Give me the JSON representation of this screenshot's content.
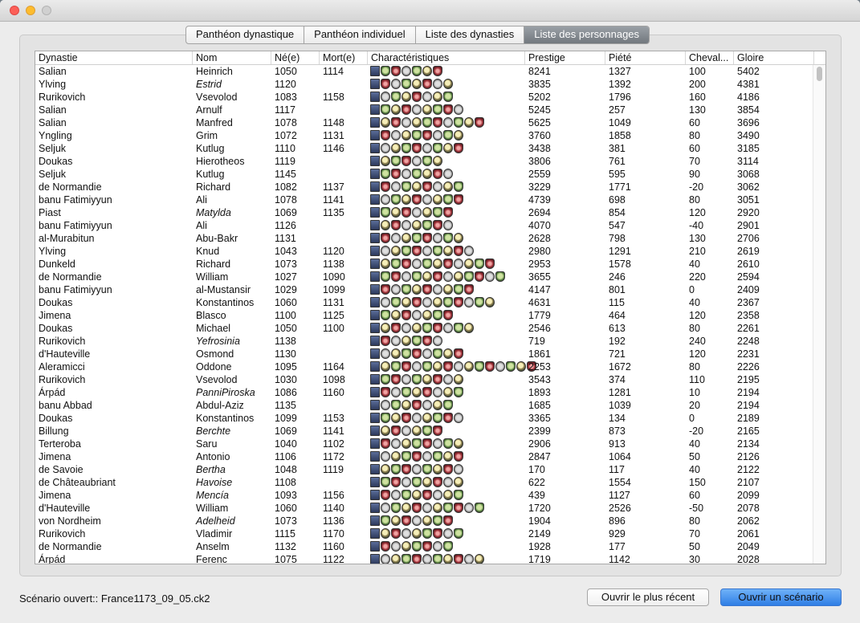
{
  "tabs": [
    {
      "label": "Panthéon dynastique",
      "active": false
    },
    {
      "label": "Panthéon individuel",
      "active": false
    },
    {
      "label": "Liste des dynasties",
      "active": false
    },
    {
      "label": "Liste des personnages",
      "active": true
    }
  ],
  "table": {
    "columns": [
      "Dynastie",
      "Nom",
      "Né(e)",
      "Mort(e)",
      "Charactéristiques",
      "Prestige",
      "Piété",
      "Cheval...",
      "Gloire"
    ],
    "rows": [
      {
        "dynasty": "Salian",
        "name": "Heinrich",
        "italic": false,
        "born": "1050",
        "died": "1114",
        "traits": 7,
        "prestige": "8241",
        "piety": "1327",
        "chivalry": "100",
        "glory": "5402"
      },
      {
        "dynasty": "Ylving",
        "name": "Estrid",
        "italic": true,
        "born": "1120",
        "died": "",
        "traits": 8,
        "prestige": "3835",
        "piety": "1392",
        "chivalry": "200",
        "glory": "4381"
      },
      {
        "dynasty": "Rurikovich",
        "name": "Vsevolod",
        "italic": false,
        "born": "1083",
        "died": "1158",
        "traits": 8,
        "prestige": "5202",
        "piety": "1796",
        "chivalry": "160",
        "glory": "4186"
      },
      {
        "dynasty": "Salian",
        "name": "Arnulf",
        "italic": false,
        "born": "1117",
        "died": "",
        "traits": 9,
        "prestige": "5245",
        "piety": "257",
        "chivalry": "130",
        "glory": "3854"
      },
      {
        "dynasty": "Salian",
        "name": "Manfred",
        "italic": false,
        "born": "1078",
        "died": "1148",
        "traits": 11,
        "prestige": "5625",
        "piety": "1049",
        "chivalry": "60",
        "glory": "3696"
      },
      {
        "dynasty": "Yngling",
        "name": "Grim",
        "italic": false,
        "born": "1072",
        "died": "1131",
        "traits": 9,
        "prestige": "3760",
        "piety": "1858",
        "chivalry": "80",
        "glory": "3490"
      },
      {
        "dynasty": "Seljuk",
        "name": "Kutlug",
        "italic": false,
        "born": "1110",
        "died": "1146",
        "traits": 9,
        "prestige": "3438",
        "piety": "381",
        "chivalry": "60",
        "glory": "3185"
      },
      {
        "dynasty": "Doukas",
        "name": "Hierotheos",
        "italic": false,
        "born": "1119",
        "died": "",
        "traits": 7,
        "prestige": "3806",
        "piety": "761",
        "chivalry": "70",
        "glory": "3114"
      },
      {
        "dynasty": "Seljuk",
        "name": "Kutlug",
        "italic": false,
        "born": "1145",
        "died": "",
        "traits": 8,
        "prestige": "2559",
        "piety": "595",
        "chivalry": "90",
        "glory": "3068"
      },
      {
        "dynasty": "de Normandie",
        "name": "Richard",
        "italic": false,
        "born": "1082",
        "died": "1137",
        "traits": 9,
        "prestige": "3229",
        "piety": "1771",
        "chivalry": "-20",
        "glory": "3062"
      },
      {
        "dynasty": "banu Fatimiyyun",
        "name": "Ali",
        "italic": false,
        "born": "1078",
        "died": "1141",
        "traits": 9,
        "prestige": "4739",
        "piety": "698",
        "chivalry": "80",
        "glory": "3051"
      },
      {
        "dynasty": "Piast",
        "name": "Matylda",
        "italic": true,
        "born": "1069",
        "died": "1135",
        "traits": 8,
        "prestige": "2694",
        "piety": "854",
        "chivalry": "120",
        "glory": "2920"
      },
      {
        "dynasty": "banu Fatimiyyun",
        "name": "Ali",
        "italic": false,
        "born": "1126",
        "died": "",
        "traits": 8,
        "prestige": "4070",
        "piety": "547",
        "chivalry": "-40",
        "glory": "2901"
      },
      {
        "dynasty": "al-Murabitun",
        "name": "Abu-Bakr",
        "italic": false,
        "born": "1131",
        "died": "",
        "traits": 9,
        "prestige": "2628",
        "piety": "798",
        "chivalry": "130",
        "glory": "2706"
      },
      {
        "dynasty": "Ylving",
        "name": "Knud",
        "italic": false,
        "born": "1043",
        "died": "1120",
        "traits": 10,
        "prestige": "2980",
        "piety": "1291",
        "chivalry": "210",
        "glory": "2619"
      },
      {
        "dynasty": "Dunkeld",
        "name": "Richard",
        "italic": false,
        "born": "1073",
        "died": "1138",
        "traits": 12,
        "prestige": "2953",
        "piety": "1578",
        "chivalry": "40",
        "glory": "2610"
      },
      {
        "dynasty": "de Normandie",
        "name": "William",
        "italic": false,
        "born": "1027",
        "died": "1090",
        "traits": 13,
        "prestige": "3655",
        "piety": "246",
        "chivalry": "220",
        "glory": "2594"
      },
      {
        "dynasty": "banu Fatimiyyun",
        "name": "al-Mustansir",
        "italic": false,
        "born": "1029",
        "died": "1099",
        "traits": 10,
        "prestige": "4147",
        "piety": "801",
        "chivalry": "0",
        "glory": "2409"
      },
      {
        "dynasty": "Doukas",
        "name": "Konstantinos",
        "italic": false,
        "born": "1060",
        "died": "1131",
        "traits": 12,
        "prestige": "4631",
        "piety": "115",
        "chivalry": "40",
        "glory": "2367"
      },
      {
        "dynasty": "Jimena",
        "name": "Blasco",
        "italic": false,
        "born": "1100",
        "died": "1125",
        "traits": 8,
        "prestige": "1779",
        "piety": "464",
        "chivalry": "120",
        "glory": "2358"
      },
      {
        "dynasty": "Doukas",
        "name": "Michael",
        "italic": false,
        "born": "1050",
        "died": "1100",
        "traits": 10,
        "prestige": "2546",
        "piety": "613",
        "chivalry": "80",
        "glory": "2261"
      },
      {
        "dynasty": "Rurikovich",
        "name": "Yefrosinia",
        "italic": true,
        "born": "1138",
        "died": "",
        "traits": 7,
        "prestige": "719",
        "piety": "192",
        "chivalry": "240",
        "glory": "2248"
      },
      {
        "dynasty": "d'Hauteville",
        "name": "Osmond",
        "italic": false,
        "born": "1130",
        "died": "",
        "traits": 9,
        "prestige": "1861",
        "piety": "721",
        "chivalry": "120",
        "glory": "2231"
      },
      {
        "dynasty": "Aleramicci",
        "name": "Oddone",
        "italic": false,
        "born": "1095",
        "died": "1164",
        "traits": 16,
        "prestige": "2253",
        "piety": "1672",
        "chivalry": "80",
        "glory": "2226"
      },
      {
        "dynasty": "Rurikovich",
        "name": "Vsevolod",
        "italic": false,
        "born": "1030",
        "died": "1098",
        "traits": 9,
        "prestige": "3543",
        "piety": "374",
        "chivalry": "110",
        "glory": "2195"
      },
      {
        "dynasty": "Árpád",
        "name": "PanniPiroska",
        "italic": true,
        "born": "1086",
        "died": "1160",
        "traits": 9,
        "prestige": "1893",
        "piety": "1281",
        "chivalry": "10",
        "glory": "2194"
      },
      {
        "dynasty": "banu Abbad",
        "name": "Abdul-Aziz",
        "italic": false,
        "born": "1135",
        "died": "",
        "traits": 8,
        "prestige": "1685",
        "piety": "1039",
        "chivalry": "20",
        "glory": "2194"
      },
      {
        "dynasty": "Doukas",
        "name": "Konstantinos",
        "italic": false,
        "born": "1099",
        "died": "1153",
        "traits": 9,
        "prestige": "3365",
        "piety": "134",
        "chivalry": "0",
        "glory": "2189"
      },
      {
        "dynasty": "Billung",
        "name": "Berchte",
        "italic": true,
        "born": "1069",
        "died": "1141",
        "traits": 7,
        "prestige": "2399",
        "piety": "873",
        "chivalry": "-20",
        "glory": "2165"
      },
      {
        "dynasty": "Terteroba",
        "name": "Saru",
        "italic": false,
        "born": "1040",
        "died": "1102",
        "traits": 9,
        "prestige": "2906",
        "piety": "913",
        "chivalry": "40",
        "glory": "2134"
      },
      {
        "dynasty": "Jimena",
        "name": "Antonio",
        "italic": false,
        "born": "1106",
        "died": "1172",
        "traits": 9,
        "prestige": "2847",
        "piety": "1064",
        "chivalry": "50",
        "glory": "2126"
      },
      {
        "dynasty": "de Savoie",
        "name": "Bertha",
        "italic": true,
        "born": "1048",
        "died": "1119",
        "traits": 9,
        "prestige": "170",
        "piety": "117",
        "chivalry": "40",
        "glory": "2122"
      },
      {
        "dynasty": "de Châteaubriant",
        "name": "Havoise",
        "italic": true,
        "born": "1108",
        "died": "",
        "traits": 9,
        "prestige": "622",
        "piety": "1554",
        "chivalry": "150",
        "glory": "2107"
      },
      {
        "dynasty": "Jimena",
        "name": "Mencía",
        "italic": true,
        "born": "1093",
        "died": "1156",
        "traits": 9,
        "prestige": "439",
        "piety": "1127",
        "chivalry": "60",
        "glory": "2099"
      },
      {
        "dynasty": "d'Hauteville",
        "name": "William",
        "italic": false,
        "born": "1060",
        "died": "1140",
        "traits": 11,
        "prestige": "1720",
        "piety": "2526",
        "chivalry": "-50",
        "glory": "2078"
      },
      {
        "dynasty": "von Nordheim",
        "name": "Adelheid",
        "italic": true,
        "born": "1073",
        "died": "1136",
        "traits": 8,
        "prestige": "1904",
        "piety": "896",
        "chivalry": "80",
        "glory": "2062"
      },
      {
        "dynasty": "Rurikovich",
        "name": "Vladimir",
        "italic": false,
        "born": "1115",
        "died": "1170",
        "traits": 9,
        "prestige": "2149",
        "piety": "929",
        "chivalry": "70",
        "glory": "2061"
      },
      {
        "dynasty": "de Normandie",
        "name": "Anselm",
        "italic": false,
        "born": "1132",
        "died": "1160",
        "traits": 8,
        "prestige": "1928",
        "piety": "177",
        "chivalry": "50",
        "glory": "2049"
      },
      {
        "dynasty": "Árpád",
        "name": "Ferenc",
        "italic": false,
        "born": "1075",
        "died": "1122",
        "traits": 11,
        "prestige": "1719",
        "piety": "1142",
        "chivalry": "30",
        "glory": "2028"
      }
    ]
  },
  "footer": {
    "status": "Scénario ouvert:: France1173_09_05.ck2",
    "open_recent_label": "Ouvrir le plus récent",
    "open_scenario_label": "Ouvrir un scénario"
  },
  "colors": {
    "primary_button": "#2f7ee5",
    "active_tab": "#7a8086"
  }
}
